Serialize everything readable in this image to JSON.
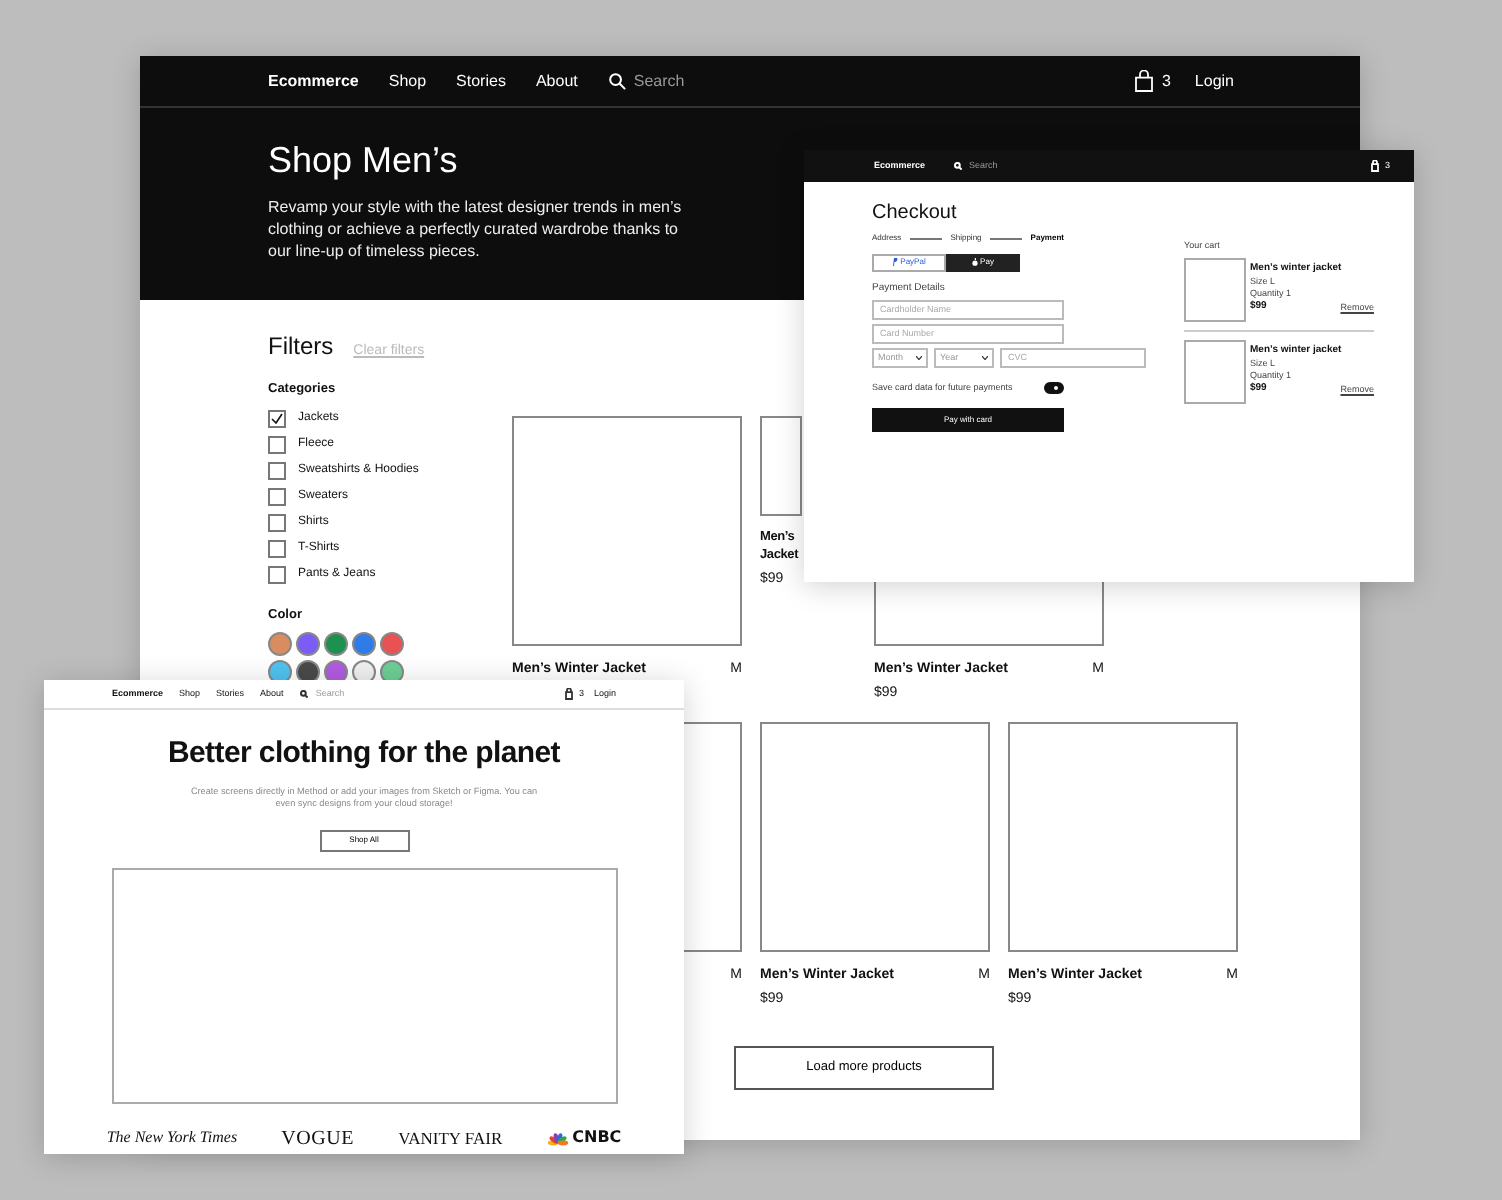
{
  "main_page": {
    "nav": {
      "brand": "Ecommerce",
      "links": [
        "Shop",
        "Stories",
        "About"
      ],
      "search_placeholder": "Search",
      "cart_count": "3",
      "login": "Login"
    },
    "hero": {
      "title": "Shop Men’s",
      "text": "Revamp your style with the latest designer trends in men’s clothing or achieve a perfectly curated wardrobe thanks to our line-up of timeless pieces."
    },
    "filters": {
      "title": "Filters",
      "clear": "Clear filters",
      "categories_title": "Categories",
      "categories": [
        {
          "label": "Jackets",
          "checked": true
        },
        {
          "label": "Fleece",
          "checked": false
        },
        {
          "label": "Sweatshirts & Hoodies",
          "checked": false
        },
        {
          "label": "Sweaters",
          "checked": false
        },
        {
          "label": "Shirts",
          "checked": false
        },
        {
          "label": "T-Shirts",
          "checked": false
        },
        {
          "label": "Pants & Jeans",
          "checked": false
        }
      ],
      "color_title": "Color",
      "colors": [
        {
          "color": "#d98c5f"
        },
        {
          "color": "#7b5cf5"
        },
        {
          "color": "#1e9150"
        },
        {
          "color": "#2f7be8"
        },
        {
          "color": "#e85252"
        },
        {
          "color": "#4fc3f0"
        },
        {
          "color": "#4a4a4a"
        },
        {
          "color": "#b05ce0"
        },
        {
          "color": "#f0f0f0"
        },
        {
          "color": "#6ccf94"
        }
      ]
    },
    "product_rows": [
      [
        {
          "kind": "tile",
          "title": "Men’s Winter Jacket",
          "size": "M"
        },
        {
          "kind": "partial",
          "title": "Men’s Jacket",
          "price": "$99"
        },
        {
          "kind": "tile",
          "title": "Men’s Winter Jacket",
          "size": "M",
          "price": "$99"
        }
      ],
      [
        {
          "kind": "tile",
          "size": "M"
        },
        {
          "kind": "tile",
          "title": "Men’s Winter Jacket",
          "size": "M",
          "price": "$99"
        },
        {
          "kind": "tile",
          "title": "Men’s Winter Jacket",
          "size": "M",
          "price": "$99"
        }
      ]
    ],
    "load_more": "Load more products"
  },
  "checkout_page": {
    "nav": {
      "brand": "Ecommerce",
      "search_placeholder": "Search",
      "cart_count": "3"
    },
    "title": "Checkout",
    "steps": [
      {
        "label": "Address",
        "selected": false
      },
      {
        "label": "Shipping",
        "selected": false
      },
      {
        "label": "Payment",
        "selected": true
      }
    ],
    "pay_methods": [
      {
        "kind": "paypal",
        "label": "PayPal"
      },
      {
        "kind": "apple",
        "label": "Pay"
      }
    ],
    "details_title": "Payment Details",
    "fields": [
      {
        "kind": "text",
        "placeholder": "Cardholder Name"
      },
      {
        "kind": "text",
        "placeholder": "Card Number"
      },
      {
        "kind": "select",
        "placeholder": "Month"
      },
      {
        "kind": "select",
        "placeholder": "Year"
      },
      {
        "kind": "text",
        "placeholder": "CVC"
      }
    ],
    "save_card": {
      "label": "Save card data for future payments",
      "on": true
    },
    "pay_button": "Pay with card",
    "cart_title": "Your cart",
    "cart_items": [
      {
        "title": "Men’s winter jacket",
        "size": "Size L",
        "quantity": "Quantity 1",
        "price": "$99",
        "remove": "Remove"
      },
      {
        "title": "Men’s winter jacket",
        "size": "Size L",
        "quantity": "Quantity 1",
        "price": "$99",
        "remove": "Remove"
      }
    ]
  },
  "home_page": {
    "nav": {
      "brand": "Ecommerce",
      "links": [
        "Shop",
        "Stories",
        "About"
      ],
      "search_placeholder": "Search",
      "cart_count": "3",
      "login": "Login"
    },
    "title": "Better clothing for the planet",
    "text": "Create screens directly in Method or add your images from Sketch or Figma. You can even sync designs from your cloud storage!",
    "button": "Shop All",
    "press": [
      {
        "kind": "nyt",
        "label": "The New York Times"
      },
      {
        "kind": "vogue",
        "label": "VOGUE"
      },
      {
        "kind": "vanity",
        "label": "VANITY FAIR"
      },
      {
        "kind": "cnbc",
        "label": "CNBC"
      }
    ]
  }
}
